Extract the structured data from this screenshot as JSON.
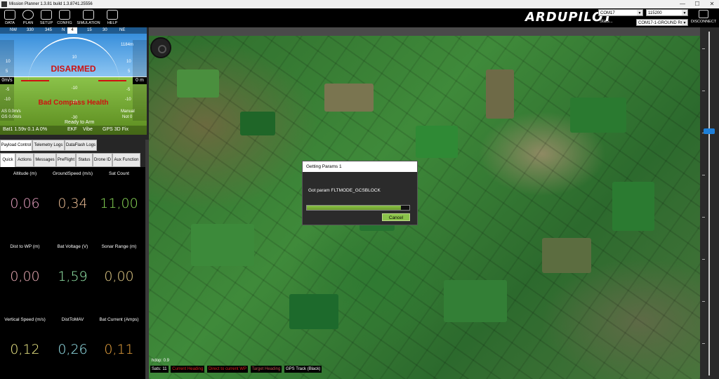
{
  "window": {
    "title": "Mission Planner 1.3.81 build 1.3.8741.25556",
    "minimize": "—",
    "maximize": "☐",
    "close": "✕"
  },
  "menu": [
    {
      "label": "DATA",
      "icon": "monitor-icon"
    },
    {
      "label": "PLAN",
      "icon": "globe-icon"
    },
    {
      "label": "SETUP",
      "icon": "setup-icon"
    },
    {
      "label": "CONFIG",
      "icon": "wrench-icon"
    },
    {
      "label": "SIMULATION",
      "icon": "simulation-icon"
    },
    {
      "label": "HELP",
      "icon": "help-icon"
    }
  ],
  "logo": "ARDUPILOT",
  "connection": {
    "port": "COM17",
    "baud": "115200",
    "stats_label": "Stats...",
    "link": "COM17-1-GROUND RC",
    "disconnect_label": "DISCONNECT"
  },
  "hud": {
    "heading_ticks": [
      "NW",
      "330",
      "345",
      "N",
      "15",
      "30",
      "NE"
    ],
    "heading_value": "4",
    "status": "DISARMED",
    "warning": "Bad Compass Health",
    "speed_value": "0m/s",
    "alt_value": "0 m",
    "left_ticks": [
      "10",
      "5",
      "-5",
      "-10"
    ],
    "right_ticks": [
      "10",
      "5",
      "-5",
      "-10"
    ],
    "pitch_ticks": [
      "10",
      "-10",
      "-20",
      "-30"
    ],
    "airspeed": "AS 0.0m/s",
    "groundspeed": "GS 0.0m/s",
    "mode": "Manual",
    "sub_mode": "Not 0",
    "alt_top": "1184m",
    "ready": "Ready to Arm",
    "battery": "Bat1 1.59v 0.1 A 0%",
    "ekf": "EKF",
    "vibe": "Vibe",
    "gps": "GPS 3D Fix"
  },
  "tabs_row1": [
    "Payload Control",
    "Telemetry Logs",
    "DataFlash Logs"
  ],
  "tabs_row2": [
    "Quick",
    "Actions",
    "Messages",
    "PreFlight",
    "Status",
    "Drone ID",
    "Aux Function"
  ],
  "quick": [
    {
      "label": "Altitude (m)",
      "value": "0,06",
      "color": "#f0a6c8"
    },
    {
      "label": "GroundSpeed (m/s)",
      "value": "0,34",
      "color": "#f4c49a"
    },
    {
      "label": "Sat Count",
      "value": "11,00",
      "color": "#8ee05a"
    },
    {
      "label": "Dist to WP (m)",
      "value": "0,00",
      "color": "#f4b2bc"
    },
    {
      "label": "Bat Voltage (V)",
      "value": "1,59",
      "color": "#9af0b0"
    },
    {
      "label": "Sonar Range (m)",
      "value": "0,00",
      "color": "#e8d08a"
    },
    {
      "label": "Vertical Speed (m/s)",
      "value": "0,12",
      "color": "#f4f08a"
    },
    {
      "label": "DistToMAV",
      "value": "0,26",
      "color": "#9ae8f0"
    },
    {
      "label": "Bat Current (Amps)",
      "value": "0,11",
      "color": "#f0a840"
    }
  ],
  "map": {
    "hdop": "hdop: 0.9",
    "sats": "Sats: 11",
    "legend": [
      {
        "label": "Current Heading",
        "color": "#e02020"
      },
      {
        "label": "Direct to current WP",
        "color": "#e02020"
      },
      {
        "label": "Target Heading",
        "color": "#c05050"
      },
      {
        "label": "GPS Track (Black)",
        "color": "#ffffff"
      }
    ]
  },
  "dialog": {
    "title": "Getting Params 1",
    "message": "Got param FLTMODE_GCSBLOCK",
    "progress": 0.92,
    "cancel_label": "Cancel"
  }
}
